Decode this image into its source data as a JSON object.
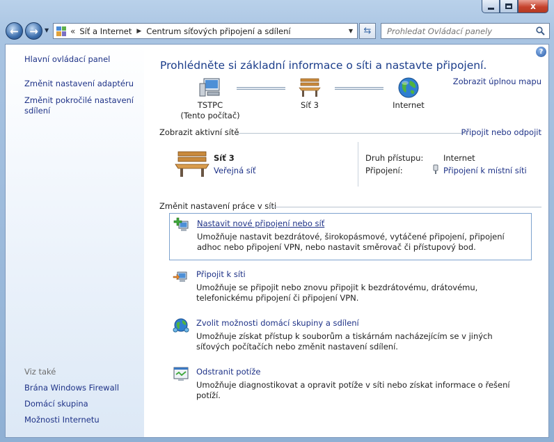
{
  "window": {
    "close_glyph": "x"
  },
  "nav": {
    "breadcrumb_root": "Síť a Internet",
    "breadcrumb_current": "Centrum síťových připojení a sdílení",
    "search_placeholder": "Prohledat Ovládací panely"
  },
  "sidebar": {
    "items": [
      {
        "label": "Hlavní ovládací panel"
      },
      {
        "label": "Změnit nastavení adaptéru"
      },
      {
        "label": "Změnit pokročilé nastavení sdílení"
      }
    ],
    "see_also_heading": "Viz také",
    "see_also": [
      {
        "label": "Brána Windows Firewall"
      },
      {
        "label": "Domácí skupina"
      },
      {
        "label": "Možnosti Internetu"
      }
    ]
  },
  "main": {
    "title": "Prohlédněte si základní informace o síti a nastavte připojení.",
    "full_map_link": "Zobrazit úplnou mapu",
    "map": {
      "computer_name": "TSTPC",
      "computer_sub": "(Tento počítač)",
      "network_name": "Síť 3",
      "internet_label": "Internet"
    },
    "active_networks": {
      "heading": "Zobrazit aktivní sítě",
      "connect_link": "Připojit nebo odpojit",
      "network_name": "Síť 3",
      "network_type": "Veřejná síť",
      "access_type_label": "Druh přístupu:",
      "access_type_value": "Internet",
      "connections_label": "Připojení:",
      "connections_value": "Připojení k místní síti"
    },
    "change_settings": {
      "heading": "Změnit nastavení práce v síti",
      "tasks": [
        {
          "title": "Nastavit nové připojení nebo síť",
          "desc": "Umožňuje nastavit bezdrátové, širokopásmové, vytáčené připojení, připojení adhoc nebo připojení VPN, nebo nastavit směrovač či přístupový bod."
        },
        {
          "title": "Připojit k síti",
          "desc": "Umožňuje se připojit nebo znovu připojit k bezdrátovému, drátovému, telefonickému připojení či připojení VPN."
        },
        {
          "title": "Zvolit možnosti domácí skupiny a sdílení",
          "desc": "Umožňuje získat přístup k souborům a tiskárnám nacházejícím se v jiných síťových počítačích nebo změnit nastavení sdílení."
        },
        {
          "title": "Odstranit potíže",
          "desc": "Umožňuje diagnostikovat a opravit potíže v síti nebo získat informace o řešení potíží."
        }
      ]
    }
  }
}
